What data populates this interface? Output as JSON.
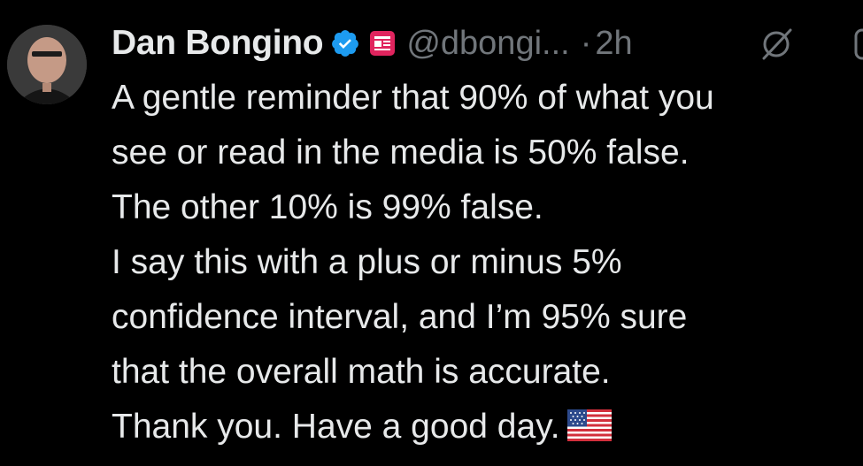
{
  "author": {
    "name": "Dan Bongino",
    "handle": "@dbongi...",
    "separator": "·",
    "time": "2h",
    "avatar_icon": "avatar-photo"
  },
  "icons": {
    "verified": "verified-badge-icon",
    "label": "media-label-icon",
    "grok": "grok-icon",
    "more": "more-options-icon"
  },
  "body": {
    "lines": [
      "A gentle reminder that 90% of what you",
      "see or read in the media is 50% false.",
      "The other 10% is 99% false.",
      "I say this with a plus or minus 5%",
      "confidence interval, and I’m 95% sure",
      "that the overall math is accurate.",
      "Thank you. Have a good day."
    ],
    "emoji": "flag-usa-icon"
  },
  "colors": {
    "background": "#000000",
    "text": "#e7e9ea",
    "muted": "#71767b",
    "verified": "#1d9bf0",
    "label_red": "#e0245e"
  }
}
